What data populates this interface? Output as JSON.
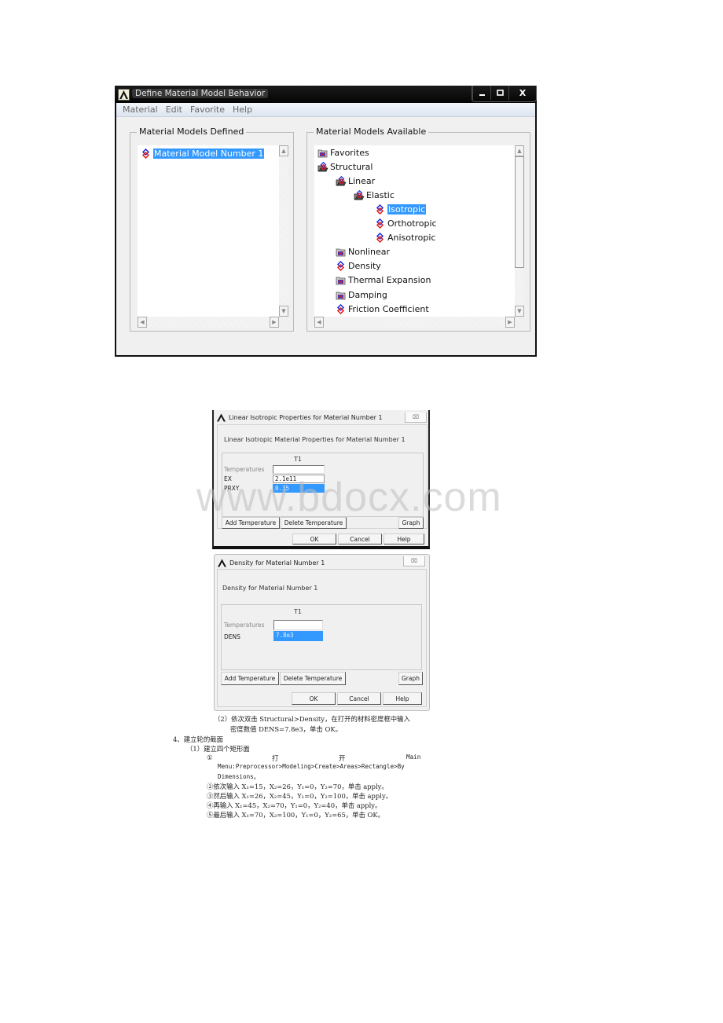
{
  "window1": {
    "title": "Define Material Model Behavior",
    "controls": {
      "minimize": "▁",
      "maximize": "□",
      "close": "X"
    },
    "menu": [
      "Material",
      "Edit",
      "Favorite",
      "Help"
    ],
    "defined_panel": {
      "legend": "Material Models Defined",
      "items": [
        {
          "label": "Material Model Number 1",
          "icon": "material-model-icon",
          "selected": true
        }
      ]
    },
    "available_panel": {
      "legend": "Material Models Available",
      "tree": [
        {
          "label": "Favorites",
          "icon": "folder-closed-icon",
          "level": 0
        },
        {
          "label": "Structural",
          "icon": "folder-open-icon",
          "level": 0
        },
        {
          "label": "Linear",
          "icon": "folder-open-icon",
          "level": 1
        },
        {
          "label": "Elastic",
          "icon": "folder-open-icon",
          "level": 2
        },
        {
          "label": "Isotropic",
          "icon": "material-model-icon",
          "level": 3,
          "selected": true
        },
        {
          "label": "Orthotropic",
          "icon": "material-model-icon",
          "level": 3
        },
        {
          "label": "Anisotropic",
          "icon": "material-model-icon",
          "level": 3
        },
        {
          "label": "Nonlinear",
          "icon": "folder-closed-icon",
          "level": 1
        },
        {
          "label": "Density",
          "icon": "material-model-icon",
          "level": 1
        },
        {
          "label": "Thermal Expansion",
          "icon": "folder-closed-icon",
          "level": 1
        },
        {
          "label": "Damping",
          "icon": "folder-closed-icon",
          "level": 1
        },
        {
          "label": "Friction Coefficient",
          "icon": "material-model-icon",
          "level": 1
        }
      ]
    }
  },
  "dialog_isotropic": {
    "title": "Linear Isotropic Properties for Material Number 1",
    "close": "⌧",
    "heading": "Linear Isotropic Material Properties for Material Number 1",
    "column": "T1",
    "rows": [
      {
        "label": "Temperatures",
        "value": ""
      },
      {
        "label": "EX",
        "value": "2.1e11"
      },
      {
        "label": "PRXY",
        "value": "0.35",
        "selected": true
      }
    ],
    "buttons": {
      "add_temp": "Add Temperature",
      "delete_temp": "Delete Temperature",
      "graph": "Graph",
      "ok": "OK",
      "cancel": "Cancel",
      "help": "Help"
    }
  },
  "dialog_density": {
    "title": "Density for Material Number 1",
    "close": "⌧",
    "heading": "Density for Material Number 1",
    "column": "T1",
    "rows": [
      {
        "label": "Temperatures",
        "value": ""
      },
      {
        "label": "DENS",
        "value": "7.8e3",
        "selected": true
      }
    ],
    "buttons": {
      "add_temp": "Add Temperature",
      "delete_temp": "Delete Temperature",
      "graph": "Graph",
      "ok": "OK",
      "cancel": "Cancel",
      "help": "Help"
    }
  },
  "watermark": "www.bdocx.com",
  "document": {
    "step_2_line1": "（2）依次双击 Structural>Density，在打开的材料密度框中输入",
    "step_2_line2": "密度数值 DENS=7.8e3，单击 OK。",
    "section_4": "4、建立轮的截面",
    "sub_1": "（1）建立四个矩形面",
    "item_1_prefix": "①",
    "item_1_word1": "打",
    "item_1_word2": "开",
    "item_1_word3": "Main",
    "item_1_line2": "Menu:Preprocessor>Modeling>Create>Areas>Rectangle>By",
    "item_1_line3": "Dimensions。",
    "item_2": "②依次输入 X₁=15，X₂=26，Y₁=0，Y₂=70，单击 apply。",
    "item_3": "③然后输入 X₁=26，X₂=45，Y₁=0，Y₂=100，单击 apply。",
    "item_4": "④再输入 X₁=45，X₂=70，Y₁=0，Y₂=40，单击 apply。",
    "item_5": "⑤最后输入 X₁=70，X₂=100，Y₁=0，Y₂=65，单击 OK。"
  }
}
